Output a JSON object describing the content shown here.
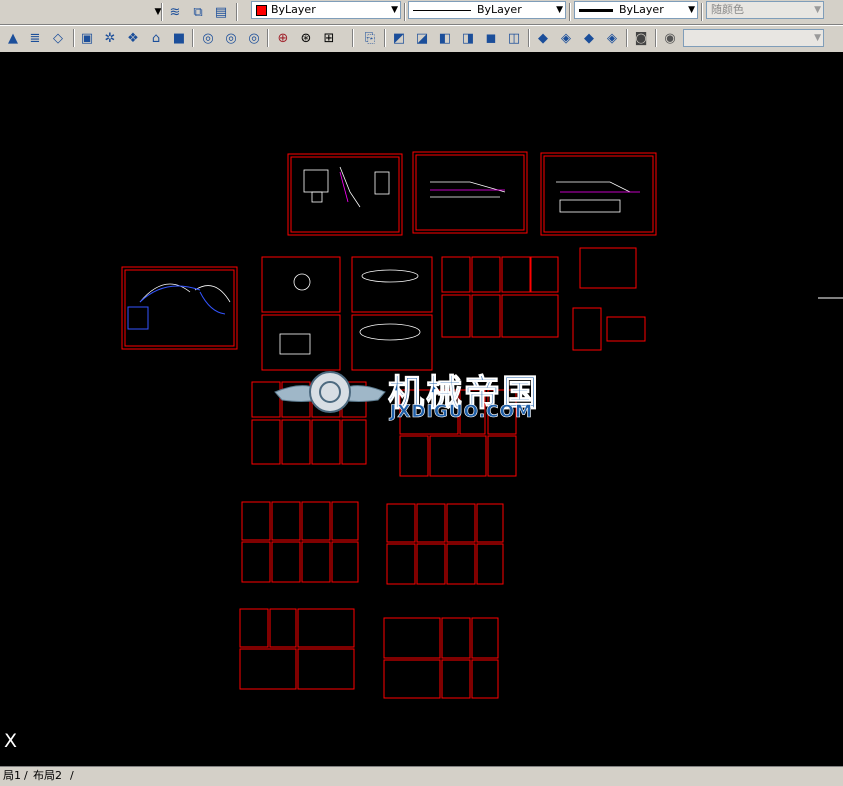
{
  "toolbar_properties": {
    "color_value": "ByLayer",
    "linetype_value": "ByLayer",
    "lineweight_value": "ByLayer",
    "plotstyle_value": "随颜色",
    "color_swatch": "#ff0000"
  },
  "toolbar_icons_row1": [
    "layer-manager-icon",
    "layer-state-icon",
    "layer-previous-icon"
  ],
  "toolbar_icons_row2": [
    "cone-icon",
    "spring-icon",
    "eraser-icon",
    "box-icon",
    "orbit-icon",
    "sweep-icon",
    "extrude-icon",
    "solid-icon",
    "union-icon",
    "subtract-icon",
    "intersect-icon",
    "ucs-icon",
    "world-icon",
    "view-icon",
    "front-view-icon",
    "top-view-icon",
    "left-view-icon",
    "right-view-icon",
    "iso-view-icon",
    "back-view-icon",
    "shade-icon",
    "wire-icon",
    "hidden-icon",
    "realistic-icon",
    "camera-icon",
    "nav-icon"
  ],
  "watermark": {
    "title": "机械帝国",
    "domain": "JXDIGUO.COM"
  },
  "ucs_label": "X",
  "layout_tabs": [
    "局1",
    "布局2"
  ],
  "colors": {
    "drawing_line": "#ff0000",
    "background": "#000000",
    "toolbar": "#d4d0c8",
    "accent_blue": "#1b4e9a"
  }
}
